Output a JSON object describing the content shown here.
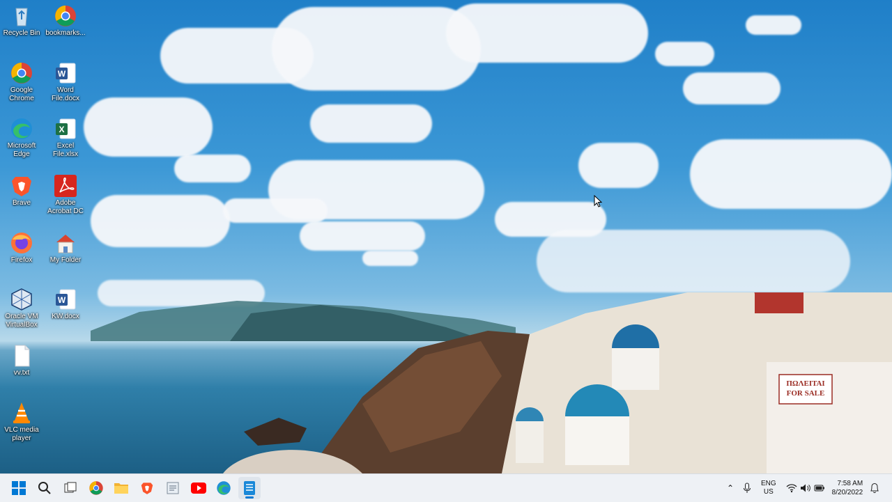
{
  "desktop": {
    "icons": [
      {
        "label": "Recycle Bin",
        "icon": "recycle-bin-icon"
      },
      {
        "label": "bookmarks...",
        "icon": "chrome-icon"
      },
      {
        "label": "Google Chrome",
        "icon": "chrome-icon"
      },
      {
        "label": "Word File.docx",
        "icon": "word-icon"
      },
      {
        "label": "Microsoft Edge",
        "icon": "edge-icon"
      },
      {
        "label": "Excel File.xlsx",
        "icon": "excel-icon"
      },
      {
        "label": "Brave",
        "icon": "brave-icon"
      },
      {
        "label": "Adobe Acrobat DC",
        "icon": "acrobat-icon"
      },
      {
        "label": "Firefox",
        "icon": "firefox-icon"
      },
      {
        "label": "My Folder",
        "icon": "folder-icon"
      },
      {
        "label": "Oracle VM VirtualBox",
        "icon": "virtualbox-icon"
      },
      {
        "label": "KW.docx",
        "icon": "word-icon"
      },
      {
        "label": "vv.txt",
        "icon": "text-file-icon"
      },
      {
        "label": "VLC media player",
        "icon": "vlc-icon"
      }
    ],
    "sign_text": {
      "line1": "ΠΩΛΕΙΤΑΙ",
      "line2": "FOR SALE"
    }
  },
  "taskbar": {
    "items": [
      {
        "name": "start-button",
        "icon": "windows-icon"
      },
      {
        "name": "search-button",
        "icon": "search-icon"
      },
      {
        "name": "task-view-button",
        "icon": "task-view-icon"
      },
      {
        "name": "chrome-taskbar",
        "icon": "chrome-icon"
      },
      {
        "name": "file-explorer-taskbar",
        "icon": "folder-icon"
      },
      {
        "name": "brave-taskbar",
        "icon": "brave-icon"
      },
      {
        "name": "notepad-taskbar",
        "icon": "notepad-icon"
      },
      {
        "name": "youtube-taskbar",
        "icon": "youtube-icon"
      },
      {
        "name": "edge-taskbar",
        "icon": "edge-icon"
      },
      {
        "name": "document-app-taskbar",
        "icon": "document-icon"
      }
    ],
    "tray": {
      "language_line1": "ENG",
      "language_line2": "US",
      "time": "7:58 AM",
      "date": "8/20/2022"
    }
  },
  "colors": {
    "taskbar_bg": "#eef1f5",
    "accent": "#0078d4"
  }
}
